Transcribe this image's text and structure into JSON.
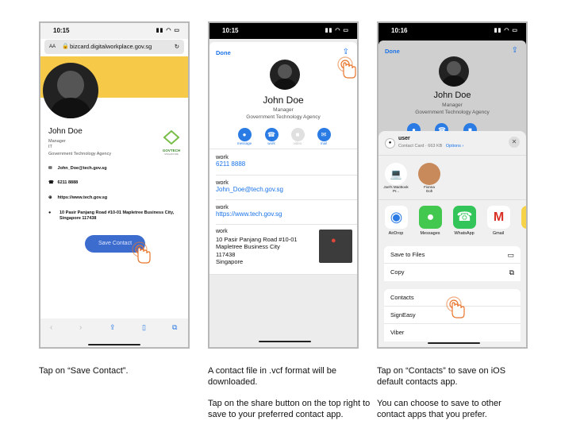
{
  "phone1": {
    "time": "10:15",
    "url": "bizcard.digitalworkplace.gov.sg",
    "aa": "AA",
    "name": "John Doe",
    "title": "Manager",
    "dept": "IT",
    "org": "Government Technology Agency",
    "logo_text": "GOVTECH",
    "logo_sub": "SINGAPORE",
    "email": "John_Doe@tech.gov.sg",
    "phone": "6211 8888",
    "website": "https://www.tech.gov.sg",
    "address": "10 Pasir Panjang Road #10-01 Mapletree Business City, Singapore 117438",
    "save_button": "Save Contact"
  },
  "phone2": {
    "time": "10:15",
    "done": "Done",
    "name": "John Doe",
    "title": "Manager",
    "org": "Government Technology Agency",
    "actions": [
      "message",
      "work",
      "video",
      "mail"
    ],
    "rows": [
      {
        "label": "work",
        "value": "6211 8888"
      },
      {
        "label": "work",
        "value": "John_Doe@tech.gov.sg"
      },
      {
        "label": "work",
        "value": "https://www.tech.gov.sg"
      }
    ],
    "address_label": "work",
    "address_lines": [
      "10 Pasir Panjang Road #10-01",
      "Mapletree Business City",
      "117438",
      "Singapore"
    ]
  },
  "phone3": {
    "time": "10:16",
    "done": "Done",
    "name": "John Doe",
    "title": "Manager",
    "org": "Government Technology Agency",
    "share_title": "user",
    "share_sub": "Contact Card · 663 KB",
    "options": "Options ›",
    "airdrop_people": [
      {
        "name": "Joel's MacBook Pr..."
      },
      {
        "name": "Fionna Goh"
      }
    ],
    "apps": [
      "AirDrop",
      "Messages",
      "WhatsApp",
      "Gmail"
    ],
    "menu1": [
      "Save to Files",
      "Copy"
    ],
    "menu2": [
      "Contacts",
      "SignEasy",
      "Viber"
    ]
  },
  "captions": {
    "c1": "Tap on “Save Contact”.",
    "c2a": "A contact file in .vcf format will be downloaded.",
    "c2b": "Tap on the share button on the top right to save to your preferred contact app.",
    "c3a": "Tap on “Contacts” to save on iOS default contacts app.",
    "c3b": "You can choose to save to other contact apps that you prefer."
  },
  "colors": {
    "accent": "#2a7be4",
    "orange": "#e8742c",
    "yellow": "#f7c948"
  }
}
